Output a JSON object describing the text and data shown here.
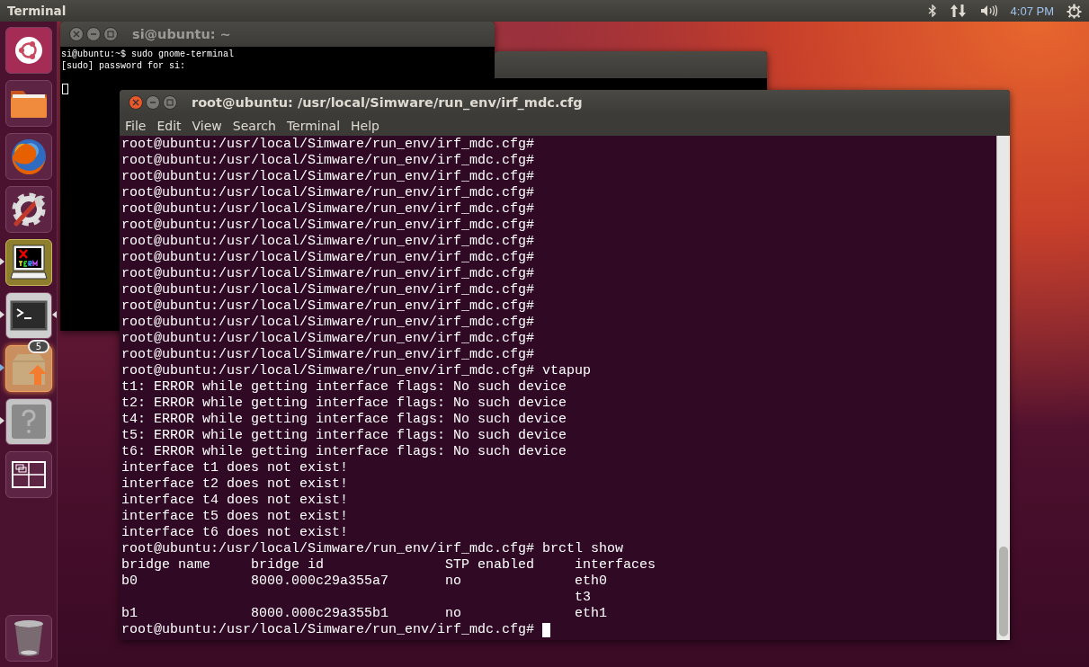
{
  "top_bar": {
    "app_title": "Terminal",
    "clock": "4:07 PM"
  },
  "launcher": {
    "items": [
      {
        "kind": "dash",
        "running": false,
        "focused": false
      },
      {
        "kind": "files",
        "running": false,
        "focused": false
      },
      {
        "kind": "firefox",
        "running": false,
        "focused": false
      },
      {
        "kind": "settings",
        "running": false,
        "focused": false
      },
      {
        "kind": "xterm",
        "running": true,
        "focused": false
      },
      {
        "kind": "terminal",
        "running": true,
        "focused": true
      },
      {
        "kind": "updater",
        "running": true,
        "focused": false,
        "badge": "5"
      },
      {
        "kind": "help",
        "running": true,
        "focused": false
      },
      {
        "kind": "workspaces",
        "running": false,
        "focused": false
      }
    ],
    "trash": {
      "kind": "trash"
    }
  },
  "back_terminal": {
    "title": "si@ubuntu: ~",
    "active": false,
    "lines": [
      "si@ubuntu:~$ sudo gnome-terminal",
      "[sudo] password for si:"
    ]
  },
  "terminal": {
    "title": "root@ubuntu: /usr/local/Simware/run_env/irf_mdc.cfg",
    "active": true,
    "menu": [
      "File",
      "Edit",
      "View",
      "Search",
      "Terminal",
      "Help"
    ],
    "lines": [
      "root@ubuntu:/usr/local/Simware/run_env/irf_mdc.cfg#",
      "root@ubuntu:/usr/local/Simware/run_env/irf_mdc.cfg#",
      "root@ubuntu:/usr/local/Simware/run_env/irf_mdc.cfg#",
      "root@ubuntu:/usr/local/Simware/run_env/irf_mdc.cfg#",
      "root@ubuntu:/usr/local/Simware/run_env/irf_mdc.cfg#",
      "root@ubuntu:/usr/local/Simware/run_env/irf_mdc.cfg#",
      "root@ubuntu:/usr/local/Simware/run_env/irf_mdc.cfg#",
      "root@ubuntu:/usr/local/Simware/run_env/irf_mdc.cfg#",
      "root@ubuntu:/usr/local/Simware/run_env/irf_mdc.cfg#",
      "root@ubuntu:/usr/local/Simware/run_env/irf_mdc.cfg#",
      "root@ubuntu:/usr/local/Simware/run_env/irf_mdc.cfg#",
      "root@ubuntu:/usr/local/Simware/run_env/irf_mdc.cfg#",
      "root@ubuntu:/usr/local/Simware/run_env/irf_mdc.cfg#",
      "root@ubuntu:/usr/local/Simware/run_env/irf_mdc.cfg#",
      "root@ubuntu:/usr/local/Simware/run_env/irf_mdc.cfg# vtapup",
      "t1: ERROR while getting interface flags: No such device",
      "t2: ERROR while getting interface flags: No such device",
      "t4: ERROR while getting interface flags: No such device",
      "t5: ERROR while getting interface flags: No such device",
      "t6: ERROR while getting interface flags: No such device",
      "interface t1 does not exist!",
      "interface t2 does not exist!",
      "interface t4 does not exist!",
      "interface t5 does not exist!",
      "interface t6 does not exist!",
      "root@ubuntu:/usr/local/Simware/run_env/irf_mdc.cfg# brctl show",
      "bridge name     bridge id               STP enabled     interfaces",
      "b0              8000.000c29a355a7       no              eth0",
      "                                                        t3",
      "b1              8000.000c29a355b1       no              eth1",
      "root@ubuntu:/usr/local/Simware/run_env/irf_mdc.cfg#"
    ]
  }
}
